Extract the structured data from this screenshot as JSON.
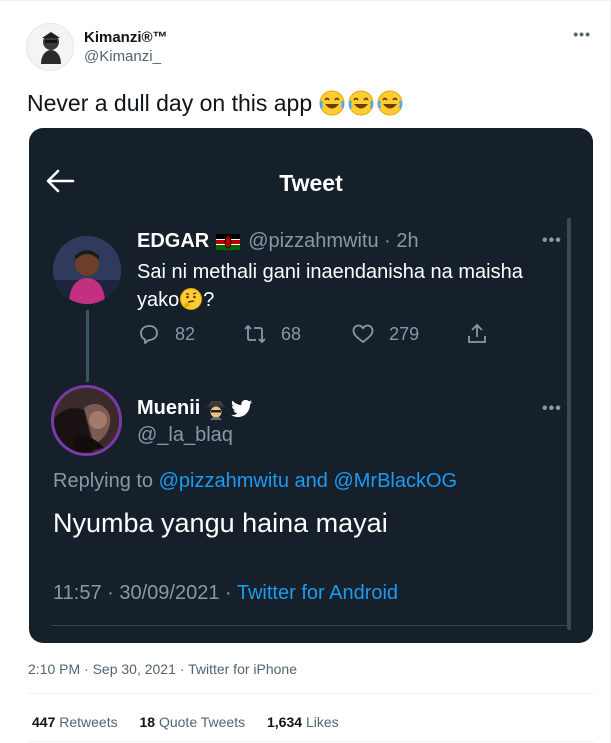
{
  "author": {
    "display_name": "Kimanzi®™",
    "handle": "@Kimanzi_",
    "more": "•••"
  },
  "tweet": {
    "text": "Never a dull day on this app"
  },
  "embedded": {
    "header_title": "Tweet",
    "parent": {
      "name": "EDGAR",
      "handle_time": "@pizzahmwitu · 2h",
      "text_line1": "Sai ni methali gani inaendanisha na maisha",
      "text_line2_prefix": "yako",
      "text_line2_suffix": "?",
      "replies": "82",
      "retweets": "68",
      "likes": "279",
      "more": "•••"
    },
    "reply": {
      "name": "Muenii",
      "handle": "@_la_blaq",
      "more": "•••",
      "replying_prefix": "Replying to ",
      "replying_user1": "@pizzahmwitu",
      "replying_and": " and ",
      "replying_user2": "@MrBlackOG",
      "body": "Nyumba yangu haina mayai",
      "time_date": "11:57 · 30/09/2021 · ",
      "client": "Twitter for Android"
    }
  },
  "footer": {
    "timestamp": "2:10 PM · Sep 30, 2021 · Twitter for iPhone",
    "retweets_count": "447",
    "retweets_label": "Retweets",
    "quotes_count": "18",
    "quotes_label": "Quote Tweets",
    "likes_count": "1,634",
    "likes_label": "Likes"
  },
  "colors": {
    "embed_bg": "#15202b",
    "link_blue": "#1d9bf0",
    "muted_gray": "#8899a6",
    "avatar_ring": "#7c3aa8"
  },
  "icons": [
    "back-arrow-icon",
    "reply-icon",
    "retweet-icon",
    "like-icon",
    "share-icon",
    "verified-bird-icon",
    "kenya-flag-icon",
    "laughing-emoji-icon",
    "thinking-emoji-icon",
    "spy-emoji-icon"
  ]
}
